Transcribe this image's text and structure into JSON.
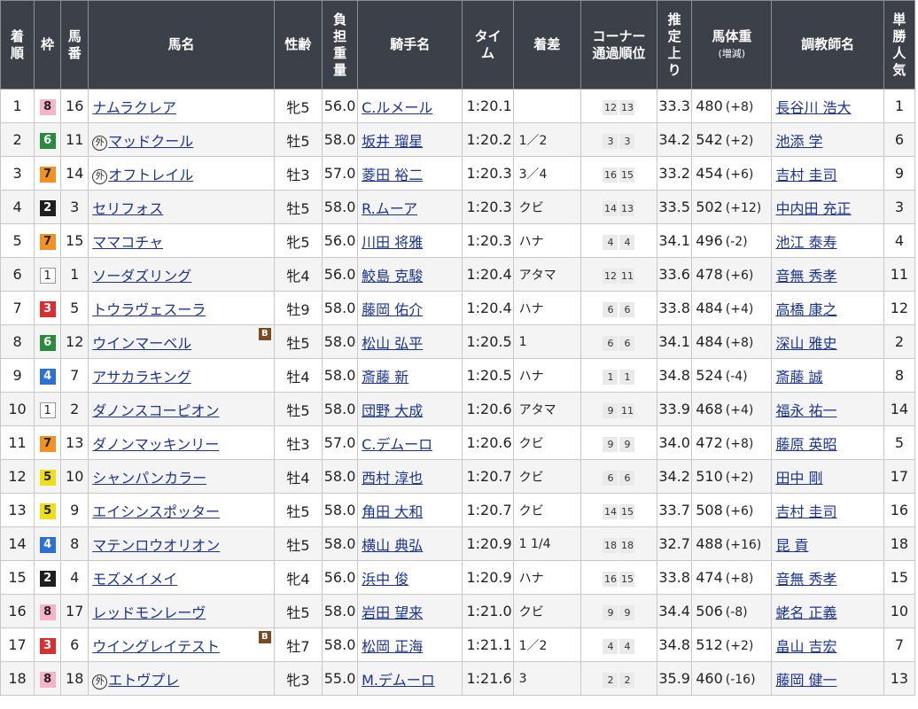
{
  "headers": {
    "rank": [
      "着",
      "順"
    ],
    "waku": "枠",
    "num": [
      "馬",
      "番"
    ],
    "name": "馬名",
    "sexage": "性齢",
    "weight": [
      "負",
      "担",
      "重",
      "量"
    ],
    "jockey": "騎手名",
    "time": [
      "タイ",
      "ム"
    ],
    "margin": "着差",
    "corner": [
      "コーナー",
      "通過順位"
    ],
    "last3f": [
      "推",
      "定",
      "上",
      "り"
    ],
    "bodyweight": [
      "馬体重",
      "(増減)"
    ],
    "trainer": "調教師名",
    "pop": [
      "単",
      "勝",
      "人",
      "気"
    ]
  },
  "rows": [
    {
      "rank": "1",
      "waku": "8",
      "num": "16",
      "foreign": "",
      "name": "ナムラクレア",
      "blinker": "",
      "sexage": "牝5",
      "weight": "56.0",
      "jockey": "C.ルメール",
      "time": "1:20.1",
      "margin": "",
      "c1": "12",
      "c2": "13",
      "last3f": "33.3",
      "bw": "480",
      "bwc": "(+8)",
      "trainer": "長谷川 浩大",
      "pop": "1"
    },
    {
      "rank": "2",
      "waku": "6",
      "num": "11",
      "foreign": "外",
      "name": "マッドクール",
      "blinker": "",
      "sexage": "牡5",
      "weight": "58.0",
      "jockey": "坂井 瑠星",
      "time": "1:20.2",
      "margin": "1／2",
      "c1": "3",
      "c2": "3",
      "last3f": "34.2",
      "bw": "542",
      "bwc": "(+2)",
      "trainer": "池添 学",
      "pop": "6"
    },
    {
      "rank": "3",
      "waku": "7",
      "num": "14",
      "foreign": "外",
      "name": "オフトレイル",
      "blinker": "",
      "sexage": "牡3",
      "weight": "57.0",
      "jockey": "菱田 裕二",
      "time": "1:20.3",
      "margin": "3／4",
      "c1": "16",
      "c2": "15",
      "last3f": "33.2",
      "bw": "454",
      "bwc": "(+6)",
      "trainer": "吉村 圭司",
      "pop": "9"
    },
    {
      "rank": "4",
      "waku": "2",
      "num": "3",
      "foreign": "",
      "name": "セリフォス",
      "blinker": "",
      "sexage": "牡5",
      "weight": "58.0",
      "jockey": "R.ムーア",
      "time": "1:20.3",
      "margin": "クビ",
      "c1": "14",
      "c2": "13",
      "last3f": "33.5",
      "bw": "502",
      "bwc": "(+12)",
      "trainer": "中内田 充正",
      "pop": "3"
    },
    {
      "rank": "5",
      "waku": "7",
      "num": "15",
      "foreign": "",
      "name": "ママコチャ",
      "blinker": "",
      "sexage": "牝5",
      "weight": "56.0",
      "jockey": "川田 将雅",
      "time": "1:20.3",
      "margin": "ハナ",
      "c1": "4",
      "c2": "4",
      "last3f": "34.1",
      "bw": "496",
      "bwc": "(-2)",
      "trainer": "池江 泰寿",
      "pop": "4"
    },
    {
      "rank": "6",
      "waku": "1",
      "num": "1",
      "foreign": "",
      "name": "ソーダズリング",
      "blinker": "",
      "sexage": "牝4",
      "weight": "56.0",
      "jockey": "鮫島 克駿",
      "time": "1:20.4",
      "margin": "アタマ",
      "c1": "12",
      "c2": "11",
      "last3f": "33.6",
      "bw": "478",
      "bwc": "(+6)",
      "trainer": "音無 秀孝",
      "pop": "11"
    },
    {
      "rank": "7",
      "waku": "3",
      "num": "5",
      "foreign": "",
      "name": "トウラヴェスーラ",
      "blinker": "",
      "sexage": "牡9",
      "weight": "58.0",
      "jockey": "藤岡 佑介",
      "time": "1:20.4",
      "margin": "ハナ",
      "c1": "6",
      "c2": "6",
      "last3f": "33.8",
      "bw": "484",
      "bwc": "(+4)",
      "trainer": "高橋 康之",
      "pop": "12"
    },
    {
      "rank": "8",
      "waku": "6",
      "num": "12",
      "foreign": "",
      "name": "ウインマーベル",
      "blinker": "B",
      "sexage": "牡5",
      "weight": "58.0",
      "jockey": "松山 弘平",
      "time": "1:20.5",
      "margin": "1",
      "c1": "6",
      "c2": "6",
      "last3f": "34.1",
      "bw": "484",
      "bwc": "(+8)",
      "trainer": "深山 雅史",
      "pop": "2"
    },
    {
      "rank": "9",
      "waku": "4",
      "num": "7",
      "foreign": "",
      "name": "アサカラキング",
      "blinker": "",
      "sexage": "牡4",
      "weight": "58.0",
      "jockey": "斎藤 新",
      "time": "1:20.5",
      "margin": "ハナ",
      "c1": "1",
      "c2": "1",
      "last3f": "34.8",
      "bw": "524",
      "bwc": "(-4)",
      "trainer": "斎藤 誠",
      "pop": "8"
    },
    {
      "rank": "10",
      "waku": "1",
      "num": "2",
      "foreign": "",
      "name": "ダノンスコーピオン",
      "blinker": "",
      "sexage": "牡5",
      "weight": "58.0",
      "jockey": "団野 大成",
      "time": "1:20.6",
      "margin": "アタマ",
      "c1": "9",
      "c2": "11",
      "last3f": "33.9",
      "bw": "468",
      "bwc": "(+4)",
      "trainer": "福永 祐一",
      "pop": "14"
    },
    {
      "rank": "11",
      "waku": "7",
      "num": "13",
      "foreign": "",
      "name": "ダノンマッキンリー",
      "blinker": "",
      "sexage": "牡3",
      "weight": "57.0",
      "jockey": "C.デムーロ",
      "time": "1:20.6",
      "margin": "クビ",
      "c1": "9",
      "c2": "9",
      "last3f": "34.0",
      "bw": "472",
      "bwc": "(+8)",
      "trainer": "藤原 英昭",
      "pop": "5"
    },
    {
      "rank": "12",
      "waku": "5",
      "num": "10",
      "foreign": "",
      "name": "シャンパンカラー",
      "blinker": "",
      "sexage": "牡4",
      "weight": "58.0",
      "jockey": "西村 淳也",
      "time": "1:20.7",
      "margin": "クビ",
      "c1": "6",
      "c2": "6",
      "last3f": "34.2",
      "bw": "510",
      "bwc": "(+2)",
      "trainer": "田中 剛",
      "pop": "17"
    },
    {
      "rank": "13",
      "waku": "5",
      "num": "9",
      "foreign": "",
      "name": "エイシンスポッター",
      "blinker": "",
      "sexage": "牡5",
      "weight": "58.0",
      "jockey": "角田 大和",
      "time": "1:20.7",
      "margin": "クビ",
      "c1": "14",
      "c2": "15",
      "last3f": "33.7",
      "bw": "508",
      "bwc": "(+6)",
      "trainer": "吉村 圭司",
      "pop": "16"
    },
    {
      "rank": "14",
      "waku": "4",
      "num": "8",
      "foreign": "",
      "name": "マテンロウオリオン",
      "blinker": "",
      "sexage": "牡5",
      "weight": "58.0",
      "jockey": "横山 典弘",
      "time": "1:20.9",
      "margin": "1 1/4",
      "c1": "18",
      "c2": "18",
      "last3f": "32.7",
      "bw": "488",
      "bwc": "(+16)",
      "trainer": "昆 貢",
      "pop": "18"
    },
    {
      "rank": "15",
      "waku": "2",
      "num": "4",
      "foreign": "",
      "name": "モズメイメイ",
      "blinker": "",
      "sexage": "牝4",
      "weight": "56.0",
      "jockey": "浜中 俊",
      "time": "1:20.9",
      "margin": "ハナ",
      "c1": "16",
      "c2": "15",
      "last3f": "33.8",
      "bw": "474",
      "bwc": "(+8)",
      "trainer": "音無 秀孝",
      "pop": "15"
    },
    {
      "rank": "16",
      "waku": "8",
      "num": "17",
      "foreign": "",
      "name": "レッドモンレーヴ",
      "blinker": "",
      "sexage": "牡5",
      "weight": "58.0",
      "jockey": "岩田 望来",
      "time": "1:21.0",
      "margin": "クビ",
      "c1": "9",
      "c2": "9",
      "last3f": "34.4",
      "bw": "506",
      "bwc": "(-8)",
      "trainer": "蛯名 正義",
      "pop": "10"
    },
    {
      "rank": "17",
      "waku": "3",
      "num": "6",
      "foreign": "",
      "name": "ウイングレイテスト",
      "blinker": "B",
      "sexage": "牡7",
      "weight": "58.0",
      "jockey": "松岡 正海",
      "time": "1:21.1",
      "margin": "1／2",
      "c1": "4",
      "c2": "4",
      "last3f": "34.8",
      "bw": "512",
      "bwc": "(+2)",
      "trainer": "畠山 吉宏",
      "pop": "7"
    },
    {
      "rank": "18",
      "waku": "8",
      "num": "18",
      "foreign": "外",
      "name": "エトヴプレ",
      "blinker": "",
      "sexage": "牝3",
      "weight": "55.0",
      "jockey": "M.デムーロ",
      "time": "1:21.6",
      "margin": "3",
      "c1": "2",
      "c2": "2",
      "last3f": "35.9",
      "bw": "460",
      "bwc": "(-16)",
      "trainer": "藤岡 健一",
      "pop": "13"
    }
  ]
}
